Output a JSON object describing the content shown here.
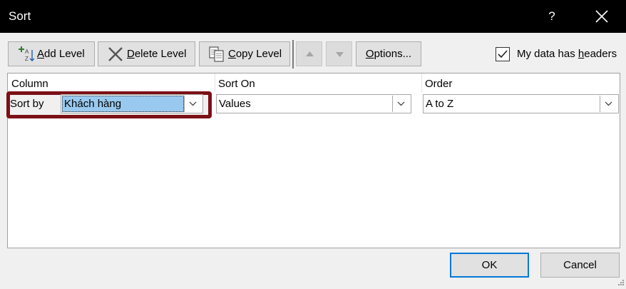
{
  "window": {
    "title": "Sort",
    "help_label": "?",
    "close_icon": "close-icon"
  },
  "toolbar": {
    "add_level": {
      "accel": "A",
      "rest": "dd Level",
      "icon": "add-level-icon"
    },
    "delete_level": {
      "accel": "D",
      "rest": "elete Level",
      "icon": "delete-icon"
    },
    "copy_level": {
      "accel": "C",
      "rest": "opy Level",
      "icon": "copy-icon"
    },
    "move_up_icon": "triangle-up-icon",
    "move_down_icon": "triangle-down-icon",
    "options": {
      "accel": "O",
      "rest": "ptions..."
    }
  },
  "headers_checkbox": {
    "checked": true,
    "label_before": "My data has ",
    "label_accel": "h",
    "label_after": "eaders"
  },
  "grid": {
    "columns": [
      "Column",
      "Sort On",
      "Order"
    ],
    "rows": [
      {
        "label": "Sort by",
        "column_value": "Khách hàng",
        "sort_on_value": "Values",
        "order_value": "A to Z"
      }
    ]
  },
  "footer": {
    "ok_label": "OK",
    "cancel_label": "Cancel"
  },
  "colors": {
    "highlight_border": "#7b1016",
    "selection": "#99c9ef",
    "default_button_border": "#0078d7"
  }
}
